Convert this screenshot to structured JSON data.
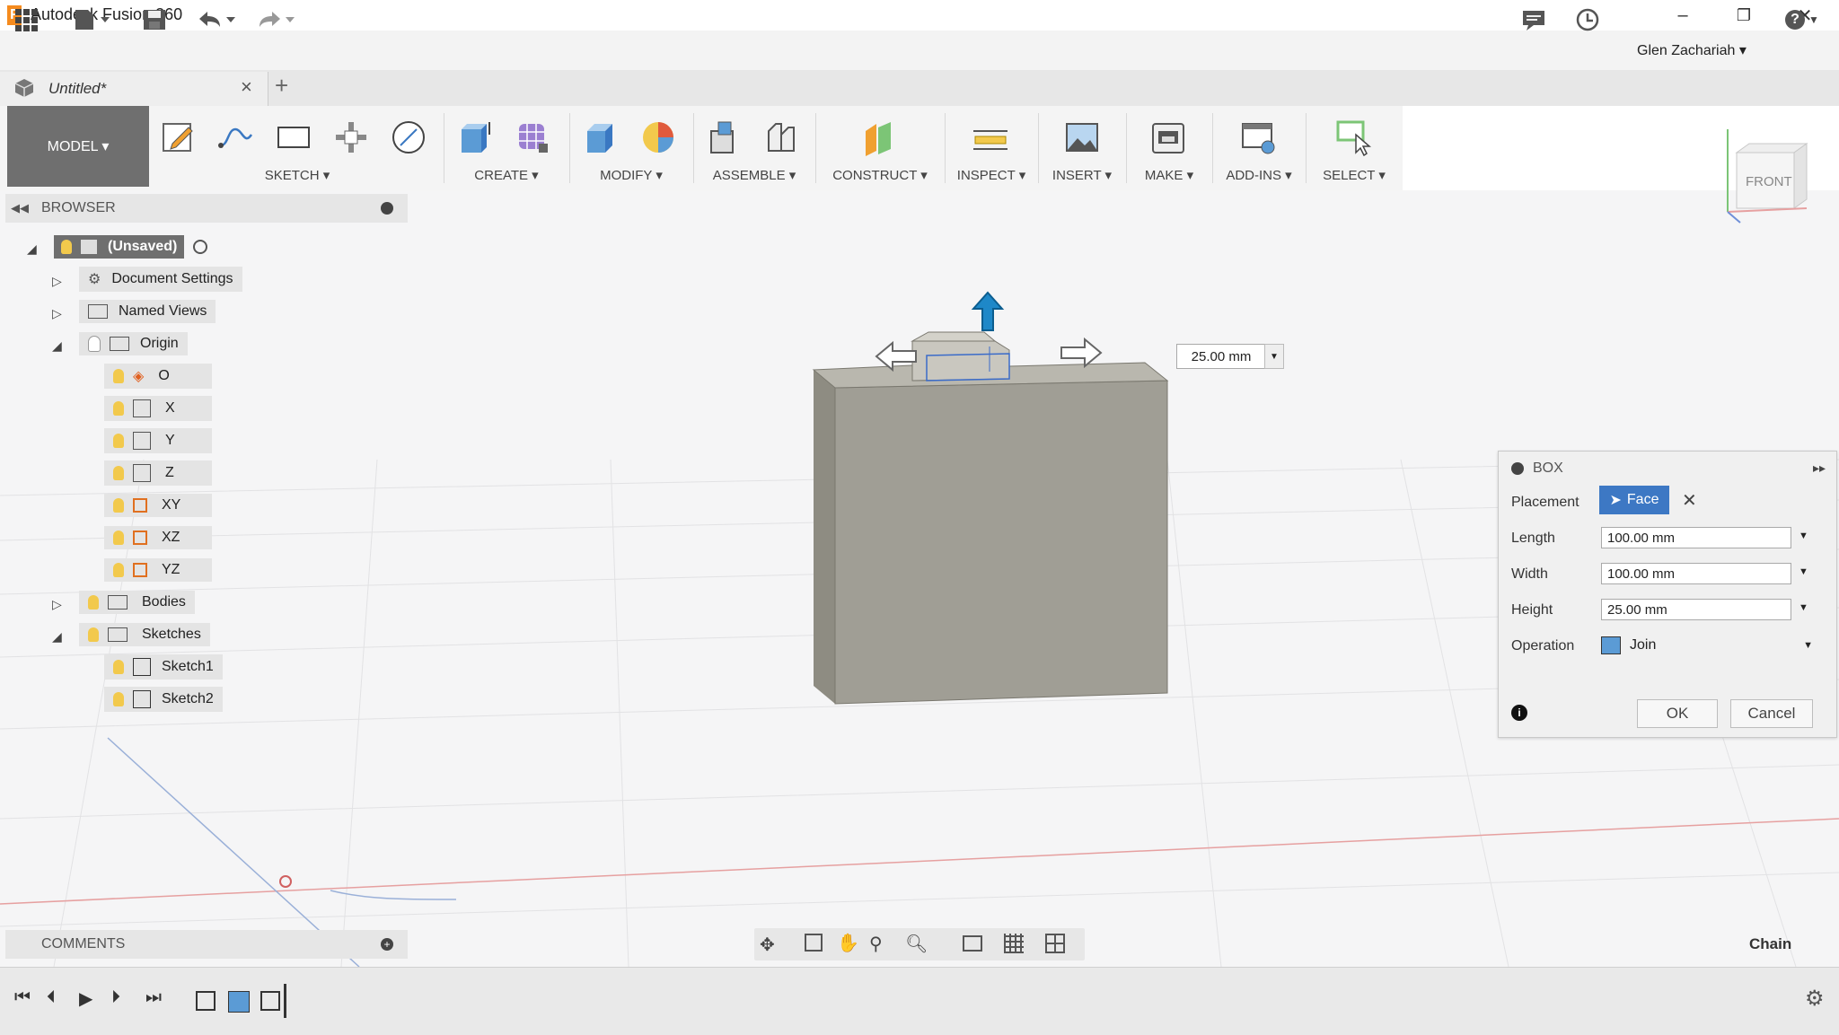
{
  "app": {
    "title": "Autodesk Fusion 360",
    "logo_letter": "F"
  },
  "window_controls": {
    "minimize": "–",
    "restore": "❐",
    "close": "✕"
  },
  "qat": {
    "user_name": "Glen Zachariah ▾",
    "help": "?▾"
  },
  "document": {
    "tab_title": "Untitled*",
    "close": "×",
    "new_tab": "+"
  },
  "ribbon": {
    "mode_button": "MODEL ▾",
    "groups": [
      {
        "label": "SKETCH ▾"
      },
      {
        "label": "CREATE ▾"
      },
      {
        "label": "MODIFY ▾"
      },
      {
        "label": "ASSEMBLE ▾"
      },
      {
        "label": "CONSTRUCT ▾"
      },
      {
        "label": "INSPECT ▾"
      },
      {
        "label": "INSERT ▾"
      },
      {
        "label": "MAKE ▾"
      },
      {
        "label": "ADD-INS ▾"
      },
      {
        "label": "SELECT ▾"
      }
    ]
  },
  "viewcube": {
    "face": "FRONT"
  },
  "browser": {
    "title": "BROWSER",
    "items": [
      {
        "label": "(Unsaved)"
      },
      {
        "label": "Document Settings"
      },
      {
        "label": "Named Views"
      },
      {
        "label": "Origin"
      },
      {
        "label": "O"
      },
      {
        "label": "X"
      },
      {
        "label": "Y"
      },
      {
        "label": "Z"
      },
      {
        "label": "XY"
      },
      {
        "label": "XZ"
      },
      {
        "label": "YZ"
      },
      {
        "label": "Bodies"
      },
      {
        "label": "Sketches"
      },
      {
        "label": "Sketch1"
      },
      {
        "label": "Sketch2"
      }
    ]
  },
  "dimension_input": {
    "value": "25.00 mm"
  },
  "box_dialog": {
    "title": "BOX",
    "placement_label": "Placement",
    "placement_value": "Face",
    "length_label": "Length",
    "length_value": "100.00 mm",
    "width_label": "Width",
    "width_value": "100.00 mm",
    "height_label": "Height",
    "height_value": "25.00 mm",
    "operation_label": "Operation",
    "operation_value": "Join",
    "ok_label": "OK",
    "cancel_label": "Cancel"
  },
  "comments": {
    "title": "COMMENTS"
  },
  "status": {
    "chain_label": "Chain"
  }
}
